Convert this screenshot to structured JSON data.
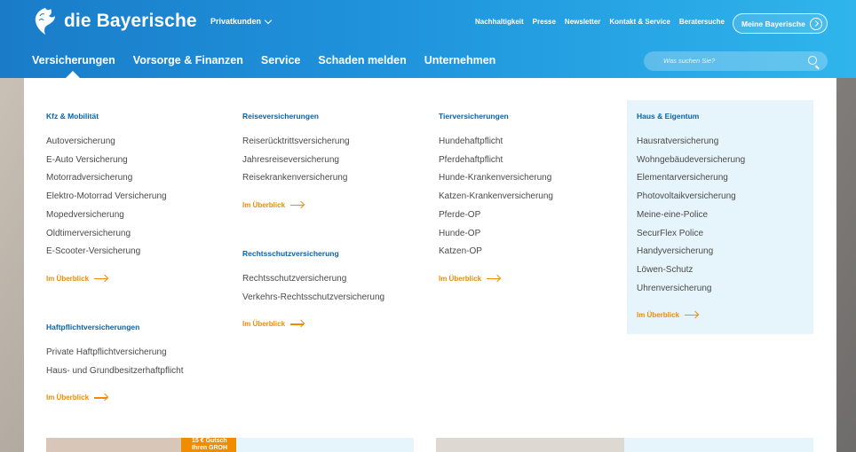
{
  "brand": {
    "name": "die Bayerische"
  },
  "segment": {
    "label": "Privatkunden"
  },
  "toplinks": [
    "Nachhaltigkeit",
    "Presse",
    "Newsletter",
    "Kontakt & Service",
    "Beratersuche"
  ],
  "account_button": {
    "label": "Meine Bayerische"
  },
  "mainnav": [
    "Versicherungen",
    "Vorsorge & Finanzen",
    "Service",
    "Schaden melden",
    "Unternehmen"
  ],
  "search": {
    "placeholder": "Was suchen Sie?"
  },
  "overview_label": "Im Überblick",
  "columns": {
    "kfz": {
      "title": "Kfz & Mobilität",
      "items": [
        "Autoversicherung",
        "E-Auto Versicherung",
        "Motorradversicherung",
        "Elektro-Motorrad Versicherung",
        "Mopedversicherung",
        "Oldtimerversicherung",
        "E-Scooter-Versicherung"
      ]
    },
    "haftpflicht": {
      "title": "Haftpflichtversicherungen",
      "items": [
        "Private Haftpflichtversicherung",
        "Haus- und Grundbesitzerhaftpflicht"
      ]
    },
    "reise": {
      "title": "Reiseversicherungen",
      "items": [
        "Reiserücktrittsversicherung",
        "Jahresreiseversicherung",
        "Reisekrankenversicherung"
      ]
    },
    "rechtsschutz": {
      "title": "Rechtsschutzversicherung",
      "items": [
        "Rechtsschutzversicherung",
        "Verkehrs-Rechtsschutzversicherung"
      ]
    },
    "tier": {
      "title": "Tierversicherungen",
      "items": [
        "Hundehaftpflicht",
        "Pferdehaftpflicht",
        "Hunde-Krankenversicherung",
        "Katzen-Krankenversicherung",
        "Pferde-OP",
        "Hunde-OP",
        "Katzen-OP"
      ]
    },
    "haus": {
      "title": "Haus & Eigentum",
      "items": [
        "Hausratversicherung",
        "Wohngebäudeversicherung",
        "Elementarversicherung",
        "Photovoltaikversicherung",
        "Meine-eine-Police",
        "SecurFlex Police",
        "Handyversicherung",
        "Löwen-Schutz",
        "Uhrenversicherung"
      ]
    }
  },
  "teaser": {
    "badge_line1": "15 € Gutsch",
    "badge_line2": "Ihren GROH"
  },
  "colors": {
    "brand_blue": "#1a7cc8",
    "heading_blue": "#0b62a5",
    "accent_orange": "#f08c00",
    "highlight_bg": "#e6f4fb"
  }
}
